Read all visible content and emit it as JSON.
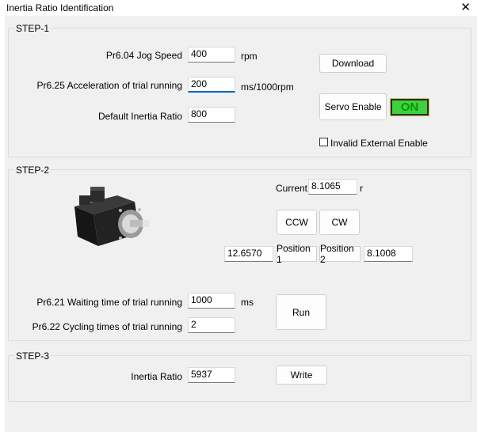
{
  "window": {
    "title": "Inertia Ratio Identification",
    "close": "✕"
  },
  "step1": {
    "title": "STEP-1",
    "jog_speed": {
      "label": "Pr6.04 Jog Speed",
      "value": "400",
      "unit": "rpm"
    },
    "acceleration": {
      "label": "Pr6.25 Acceleration of trial running",
      "value": "200",
      "unit": "ms/1000rpm"
    },
    "default_inertia": {
      "label": "Default Inertia Ratio",
      "value": "800"
    },
    "download_label": "Download",
    "servo_enable_label": "Servo Enable",
    "status_text": "ON",
    "invalid_external_label": "Invalid External Enable"
  },
  "step2": {
    "title": "STEP-2",
    "current": {
      "label": "Current",
      "value": "8.1065",
      "unit": "r"
    },
    "ccw_label": "CCW",
    "cw_label": "CW",
    "position1": {
      "value": "12.6570",
      "label": "Position 1"
    },
    "position2": {
      "value": "8.1008",
      "label": "Position 2"
    },
    "waiting_time": {
      "label": "Pr6.21 Waiting time of trial running",
      "value": "1000",
      "unit": "ms"
    },
    "cycling_times": {
      "label": "Pr6.22 Cycling times of trial running",
      "value": "2"
    },
    "run_label": "Run"
  },
  "step3": {
    "title": "STEP-3",
    "inertia_ratio": {
      "label": "Inertia Ratio",
      "value": "5937"
    },
    "write_label": "Write"
  },
  "colors": {
    "on_bg": "#40d040",
    "on_text": "#009a00",
    "focus": "#0067c0"
  }
}
